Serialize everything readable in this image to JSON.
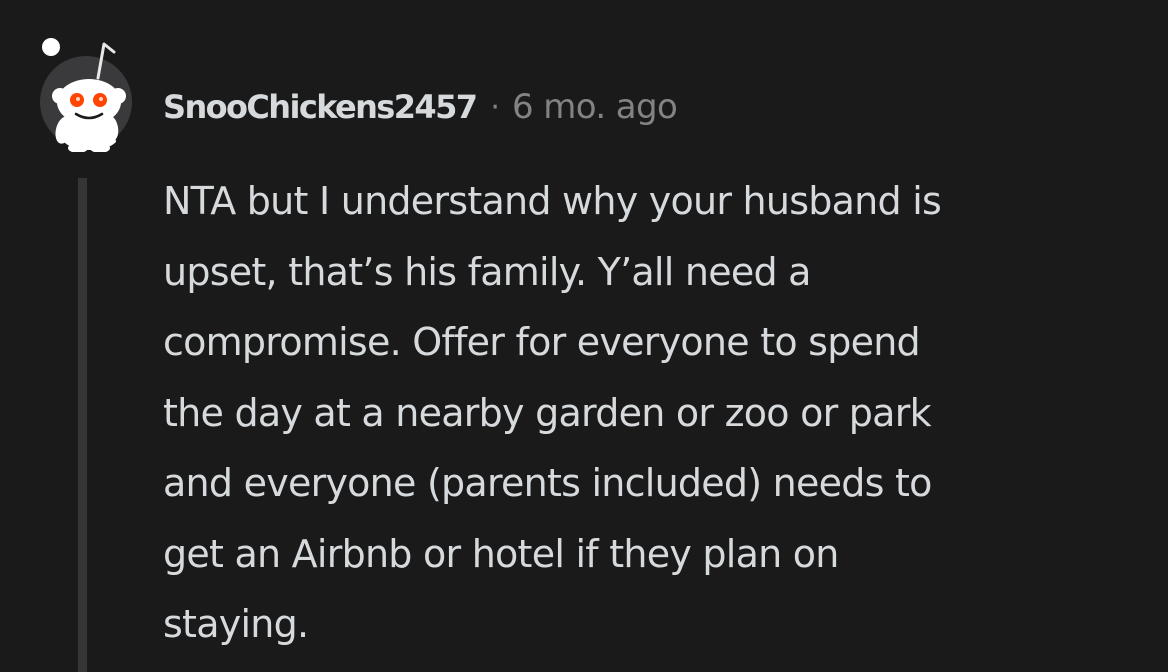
{
  "comment": {
    "author": "SnooChickens2457",
    "separator": "·",
    "timestamp": "6 mo. ago",
    "avatar_icon": "snoo-avatar-icon",
    "body_lines": [
      "NTA but I understand why your husband is",
      "upset, that’s his family. Y’all need a",
      "compromise. Offer for everyone to spend",
      "the day at a nearby garden or zoo or park",
      "and everyone (parents included) needs to",
      "get an Airbnb or hotel if they plan on",
      "staying."
    ]
  },
  "colors": {
    "background": "#1a1a1b",
    "text": "#d7dadc",
    "meta": "#818384",
    "thread_line": "#343536",
    "avatar_bg": "#3a3a3c",
    "snoo_eye": "#ff4500"
  }
}
